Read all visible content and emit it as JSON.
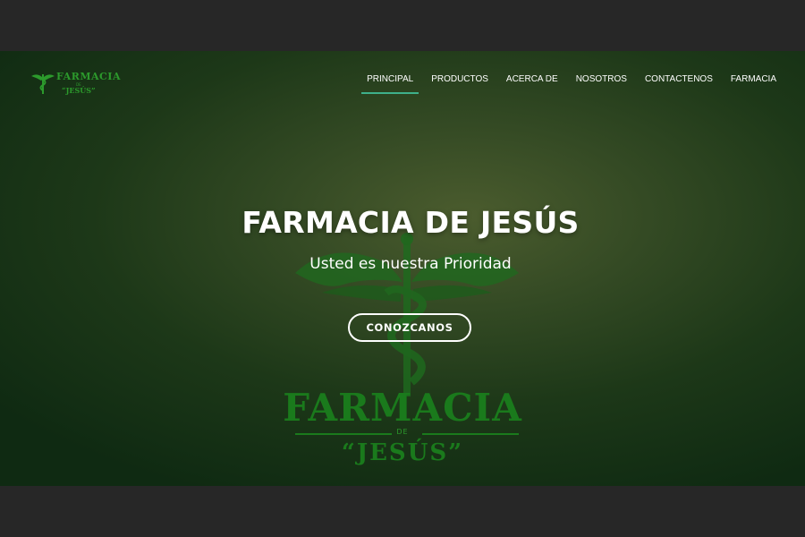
{
  "nav": {
    "logo": {
      "top": "FARMACIA",
      "mid": "DE",
      "bottom": "“JESÚS”"
    },
    "items": [
      {
        "label": "PRINCIPAL",
        "active": true
      },
      {
        "label": "PRODUCTOS",
        "active": false
      },
      {
        "label": "ACERCA DE",
        "active": false
      },
      {
        "label": "NOSOTROS",
        "active": false
      },
      {
        "label": "CONTACTENOS",
        "active": false
      },
      {
        "label": "FARMACIA",
        "active": false
      }
    ]
  },
  "hero": {
    "title": "FARMACIA DE JESÚS",
    "subtitle": "Usted es nuestra Prioridad",
    "cta_label": "CONOZCANOS",
    "emblem": {
      "icon": "caduceus-icon",
      "top": "FARMACIA",
      "mid": "DE",
      "bottom": "“JESÚS”"
    }
  },
  "colors": {
    "page_bg": "#272727",
    "hero_bg": "#1d3818",
    "accent": "#3eb08a",
    "brand_green": "#1a7a1c",
    "text": "#ffffff"
  }
}
